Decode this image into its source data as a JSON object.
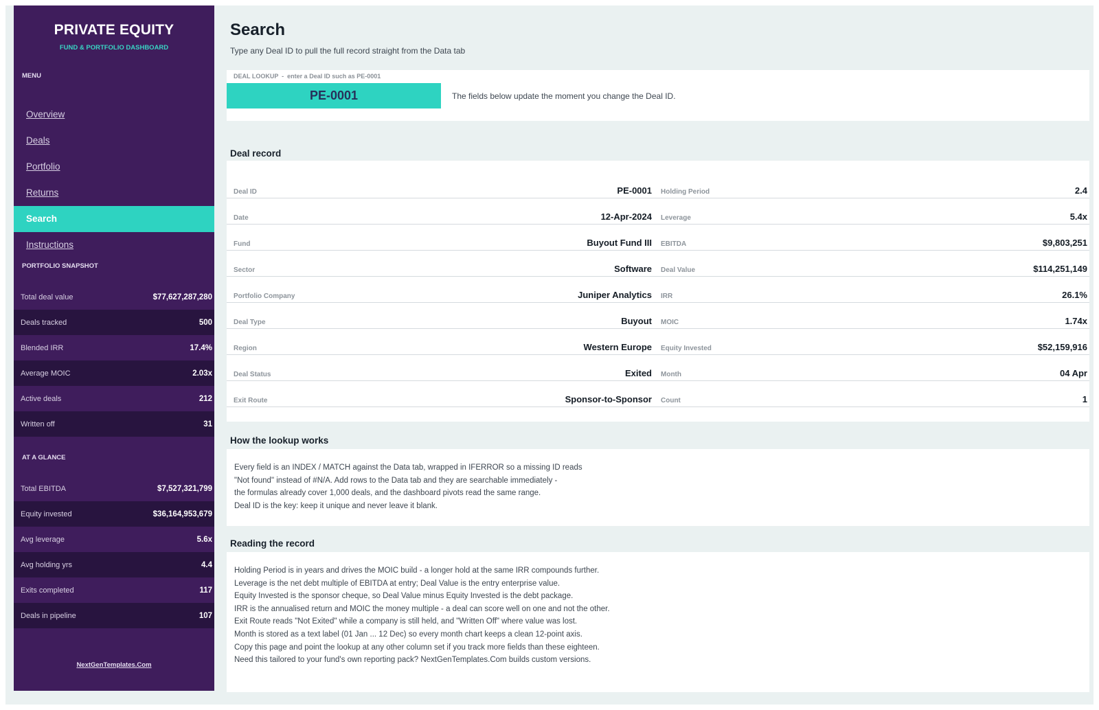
{
  "sidebar": {
    "title": "PRIVATE EQUITY",
    "subtitle": "FUND & PORTFOLIO DASHBOARD",
    "menu_label": "MENU",
    "nav": [
      "Overview",
      "Deals",
      "Portfolio",
      "Returns",
      "Search",
      "Instructions"
    ],
    "active_nav": "Search",
    "snapshot_label": "PORTFOLIO SNAPSHOT",
    "snapshot": [
      {
        "label": "Total deal value",
        "value": "$77,627,287,280"
      },
      {
        "label": "Deals tracked",
        "value": "500"
      },
      {
        "label": "Blended IRR",
        "value": "17.4%"
      },
      {
        "label": "Average MOIC",
        "value": "2.03x"
      },
      {
        "label": "Active deals",
        "value": "212"
      },
      {
        "label": "Written off",
        "value": "31"
      }
    ],
    "glance_label": "AT A GLANCE",
    "glance": [
      {
        "label": "Total EBITDA",
        "value": "$7,527,321,799"
      },
      {
        "label": "Equity invested",
        "value": "$36,164,953,679"
      },
      {
        "label": "Avg leverage",
        "value": "5.6x"
      },
      {
        "label": "Avg holding yrs",
        "value": "4.4"
      },
      {
        "label": "Exits completed",
        "value": "117"
      },
      {
        "label": "Deals in pipeline",
        "value": "107"
      }
    ],
    "footer_link": "NextGenTemplates.Com"
  },
  "main": {
    "title": "Search",
    "subtitle": "Type any Deal ID to pull the full record straight from the Data tab",
    "lookup": {
      "caption": "DEAL LOOKUP  -  enter a Deal ID such as PE-0001",
      "value": "PE-0001",
      "note": "The fields below update the moment you change the Deal ID."
    },
    "record_heading": "Deal record",
    "record_left": [
      {
        "label": "Deal ID",
        "value": "PE-0001"
      },
      {
        "label": "Date",
        "value": "12-Apr-2024"
      },
      {
        "label": "Fund",
        "value": "Buyout Fund III"
      },
      {
        "label": "Sector",
        "value": "Software"
      },
      {
        "label": "Portfolio Company",
        "value": "Juniper Analytics"
      },
      {
        "label": "Deal Type",
        "value": "Buyout"
      },
      {
        "label": "Region",
        "value": "Western Europe"
      },
      {
        "label": "Deal Status",
        "value": "Exited"
      },
      {
        "label": "Exit Route",
        "value": "Sponsor-to-Sponsor"
      }
    ],
    "record_right": [
      {
        "label": "Holding Period",
        "value": "2.4"
      },
      {
        "label": "Leverage",
        "value": "5.4x"
      },
      {
        "label": "EBITDA",
        "value": "$9,803,251"
      },
      {
        "label": "Deal Value",
        "value": "$114,251,149"
      },
      {
        "label": "IRR",
        "value": "26.1%"
      },
      {
        "label": "MOIC",
        "value": "1.74x"
      },
      {
        "label": "Equity Invested",
        "value": "$52,159,916"
      },
      {
        "label": "Month",
        "value": "04 Apr"
      },
      {
        "label": "Count",
        "value": "1"
      }
    ],
    "how_heading": "How the lookup works",
    "how_lines": [
      "Every field is an INDEX / MATCH against the Data tab, wrapped in IFERROR so a missing ID reads",
      "\"Not found\" instead of #N/A. Add rows to the Data tab and they are searchable immediately -",
      "the formulas already cover 1,000 deals, and the dashboard pivots read the same range.",
      "Deal ID is the key: keep it unique and never leave it blank."
    ],
    "reading_heading": "Reading the record",
    "reading_lines": [
      "Holding Period is in years and drives the MOIC build - a longer hold at the same IRR compounds further.",
      "Leverage is the net debt multiple of EBITDA at entry; Deal Value is the entry enterprise value.",
      "Equity Invested is the sponsor cheque, so Deal Value minus Equity Invested is the debt package.",
      "IRR is the annualised return and MOIC the money multiple - a deal can score well on one and not the other.",
      "Exit Route reads \"Not Exited\" while a company is still held, and \"Written Off\" where value was lost.",
      "Month is stored as a text label (01 Jan ... 12 Dec) so every month chart keeps a clean 12-point axis.",
      "Copy this page and point the lookup at any other column set if you track more fields than these eighteen.",
      "Need this tailored to your fund's own reporting pack? NextGenTemplates.Com builds custom versions."
    ]
  },
  "colors": {
    "sidebar_bg": "#3f1d5c",
    "sidebar_alt": "#28143f",
    "accent": "#2ed3c1",
    "page_bg": "#eaf1f1"
  }
}
